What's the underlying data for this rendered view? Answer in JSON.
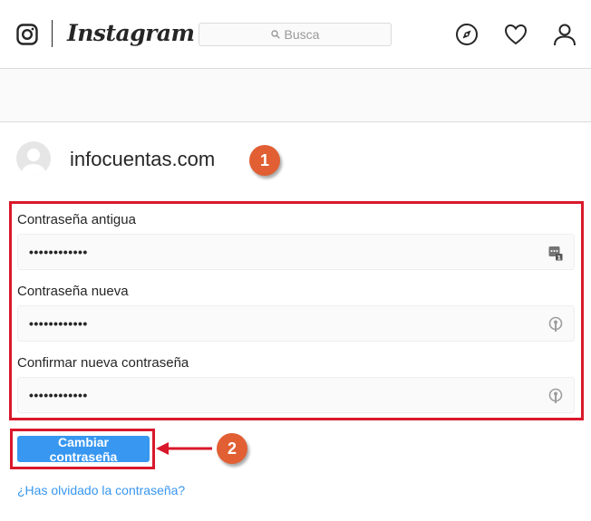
{
  "header": {
    "brand": "Instagram",
    "search_placeholder": "Busca"
  },
  "profile": {
    "username": "infocuentas.com"
  },
  "annotations": {
    "badge_1": "1",
    "badge_2": "2"
  },
  "form": {
    "old_password_label": "Contraseña antigua",
    "old_password_value": "••••••••••••",
    "new_password_label": "Contraseña nueva",
    "new_password_value": "••••••••••••",
    "confirm_password_label": "Confirmar nueva contraseña",
    "confirm_password_value": "••••••••••••",
    "submit_label": "Cambiar contraseña",
    "forgot_link": "¿Has olvidado la contraseña?"
  },
  "colors": {
    "accent": "#3897f0",
    "highlight": "#d9182b",
    "badge": "#e15f33"
  }
}
